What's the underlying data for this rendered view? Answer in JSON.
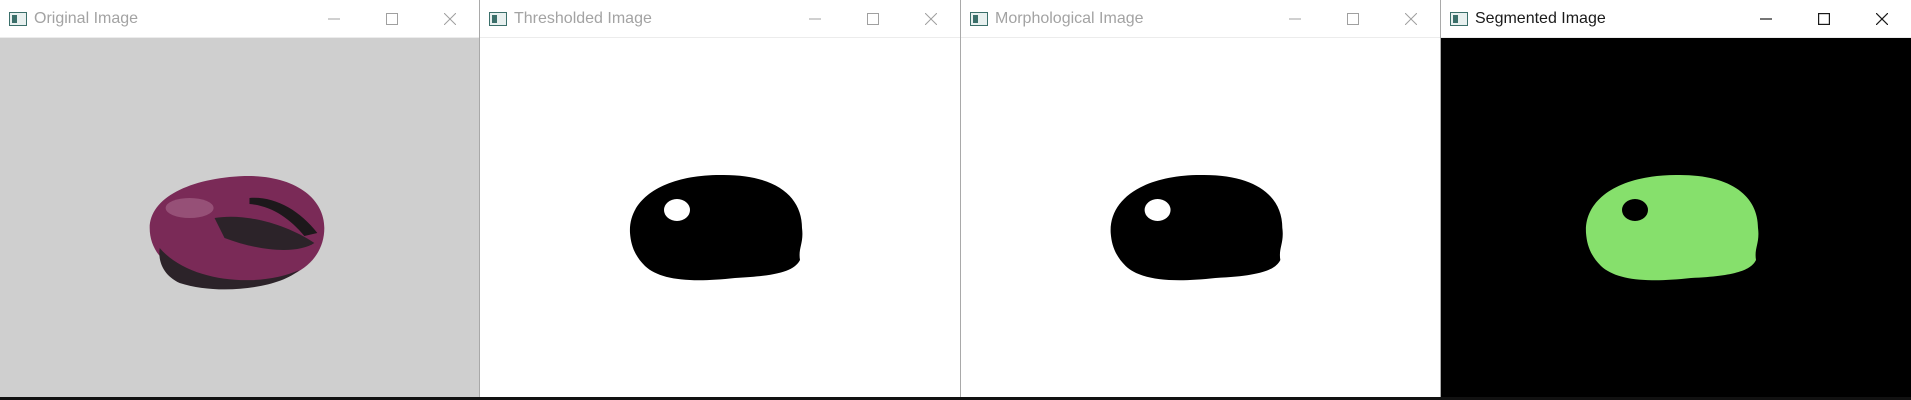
{
  "windows": [
    {
      "title": "Original Image",
      "icon": "opencv-window-icon"
    },
    {
      "title": "Thresholded Image",
      "icon": "opencv-window-icon"
    },
    {
      "title": "Morphological Image",
      "icon": "opencv-window-icon"
    },
    {
      "title": "Segmented Image",
      "icon": "opencv-window-icon"
    }
  ],
  "colors": {
    "original_background": "#cfcfcf",
    "mouse_body": "#7a2a57",
    "mouse_dark": "#2c2329",
    "threshold_background": "#ffffff",
    "threshold_blob": "#000000",
    "segmented_background": "#000000",
    "segmented_blob": "#86e06c"
  }
}
